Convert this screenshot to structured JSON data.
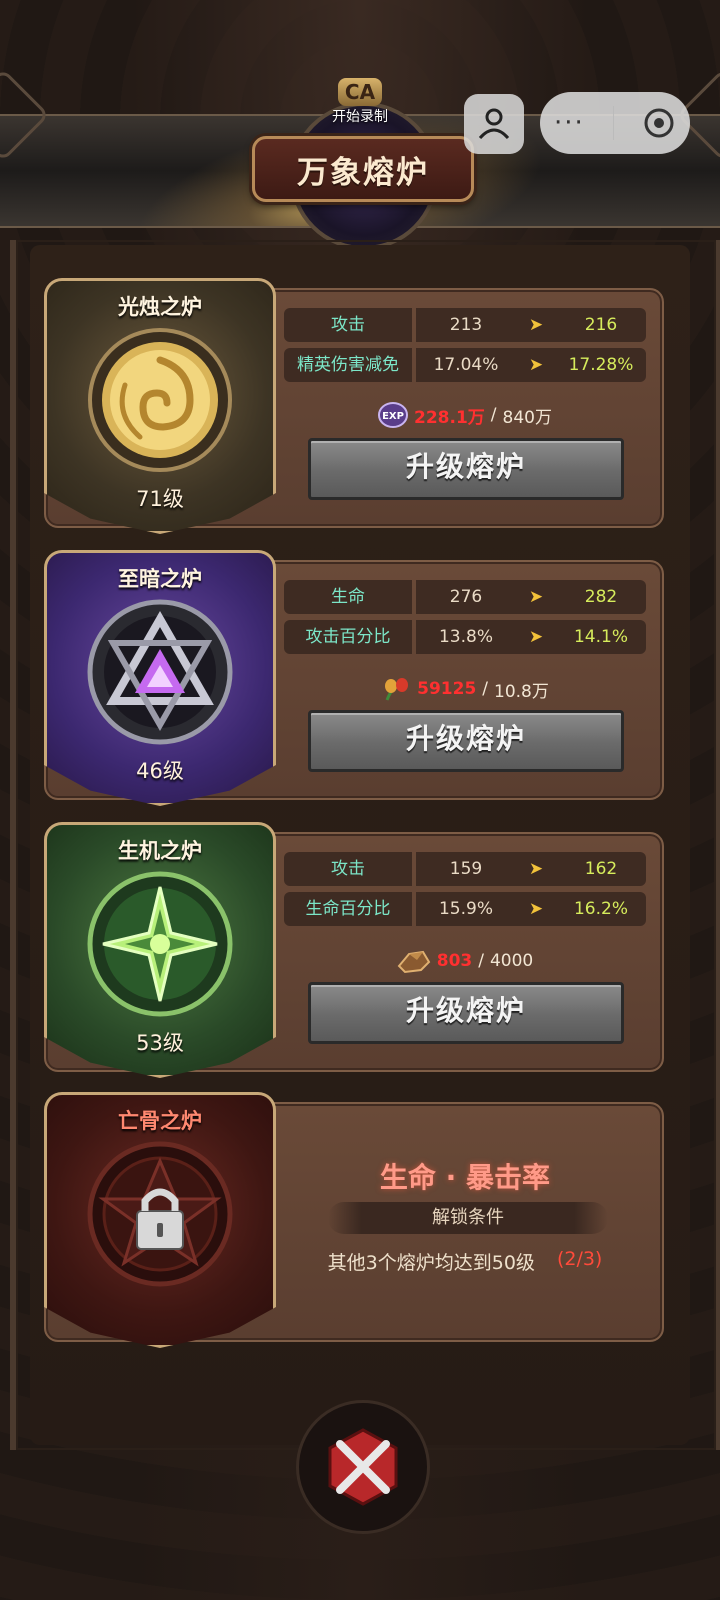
{
  "header": {
    "title": "万象熔炉",
    "record_label": "开始录制",
    "record_icon": "CA",
    "capsule_more": "···"
  },
  "furnaces": [
    {
      "name": "光烛之炉",
      "level": "71级",
      "theme": "gold",
      "stats": [
        {
          "name": "攻击",
          "current": "213",
          "next": "216"
        },
        {
          "name": "精英伤害减免",
          "current": "17.04%",
          "next": "17.28%"
        }
      ],
      "cost": {
        "icon": "exp-icon",
        "have": "228.1万",
        "need": "840万"
      },
      "button": "升级熔炉"
    },
    {
      "name": "至暗之炉",
      "level": "46级",
      "theme": "purple",
      "stats": [
        {
          "name": "生命",
          "current": "276",
          "next": "282"
        },
        {
          "name": "攻击百分比",
          "current": "13.8%",
          "next": "14.1%"
        }
      ],
      "cost": {
        "icon": "flower-icon",
        "have": "59125",
        "need": "10.8万"
      },
      "button": "升级熔炉"
    },
    {
      "name": "生机之炉",
      "level": "53级",
      "theme": "green",
      "stats": [
        {
          "name": "攻击",
          "current": "159",
          "next": "162"
        },
        {
          "name": "生命百分比",
          "current": "15.9%",
          "next": "16.2%"
        }
      ],
      "cost": {
        "icon": "ore-icon",
        "have": "803",
        "need": "4000"
      },
      "button": "升级熔炉"
    },
    {
      "name": "亡骨之炉",
      "theme": "red",
      "locked": true,
      "attributes": "生命 · 暴击率",
      "unlock_title": "解锁条件",
      "unlock_condition": "其他3个熔炉均达到50级",
      "unlock_progress": "(2/3)"
    }
  ],
  "colors": {
    "stat_name": "#7ce6c8",
    "stat_next": "#d6ec5c",
    "arrow": "#f2c23a",
    "cost_have": "#ff3030"
  }
}
